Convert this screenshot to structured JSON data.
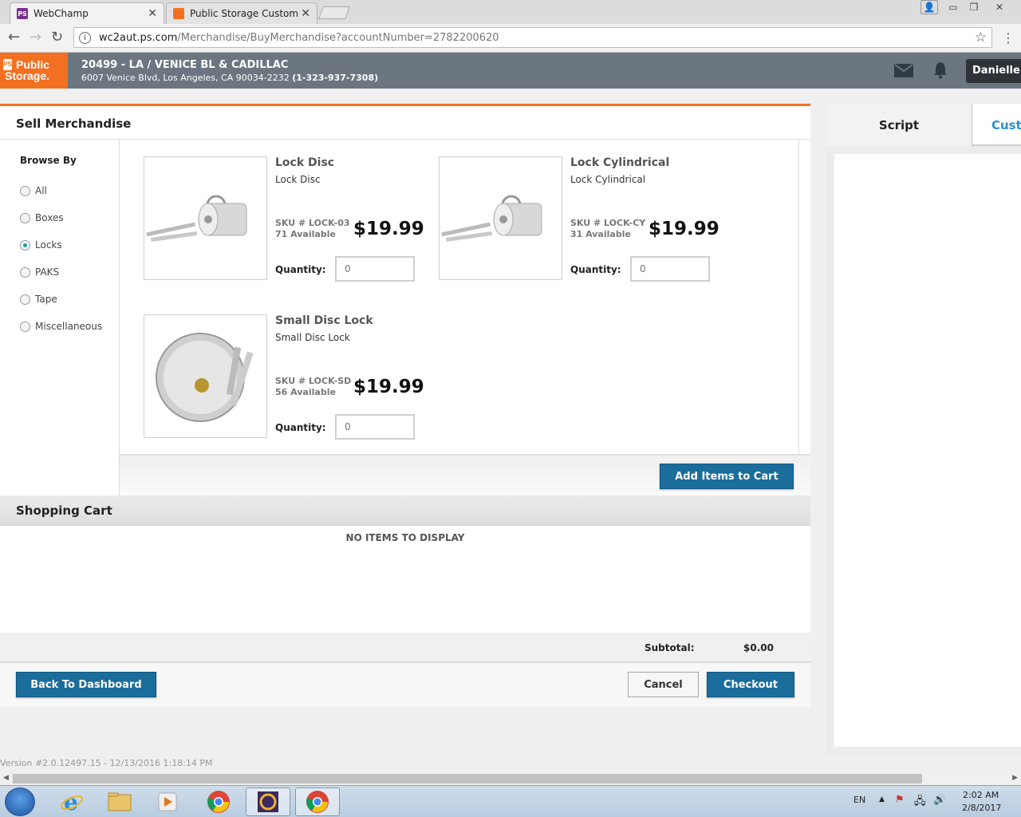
{
  "browser": {
    "tabs": [
      {
        "title": "WebChamp",
        "favicon_color": "#7b2d8e",
        "active": true
      },
      {
        "title": "Public Storage Customer",
        "favicon_color": "#f37021",
        "active": false
      }
    ],
    "url_host": "wc2aut.ps.com",
    "url_path": "/Merchandise/BuyMerchandise?accountNumber=2782200620"
  },
  "header": {
    "logo_line1": "Public",
    "logo_line2": "Storage.",
    "store_title": "20499 - LA / VENICE BL & CADILLAC",
    "store_address": "6007 Venice Blvd, Los Angeles, CA 90034-2232",
    "store_phone": "(1-323-937-7308)",
    "user_name": "Danielle"
  },
  "page": {
    "title": "Sell Merchandise",
    "browse_by_label": "Browse By",
    "categories": [
      {
        "label": "All",
        "selected": false
      },
      {
        "label": "Boxes",
        "selected": false
      },
      {
        "label": "Locks",
        "selected": true
      },
      {
        "label": "PAKS",
        "selected": false
      },
      {
        "label": "Tape",
        "selected": false
      },
      {
        "label": "Miscellaneous",
        "selected": false
      }
    ],
    "products": [
      {
        "name": "Lock Disc",
        "description": "Lock Disc",
        "sku": "SKU # LOCK-03",
        "available": "71 Available",
        "price": "$19.99",
        "quantity_label": "Quantity:",
        "quantity_value": "0"
      },
      {
        "name": "Lock Cylindrical",
        "description": "Lock Cylindrical",
        "sku": "SKU # LOCK-CY",
        "available": "31 Available",
        "price": "$19.99",
        "quantity_label": "Quantity:",
        "quantity_value": "0"
      },
      {
        "name": "Small Disc Lock",
        "description": "Small Disc Lock",
        "sku": "SKU # LOCK-SD",
        "available": "56 Available",
        "price": "$19.99",
        "quantity_label": "Quantity:",
        "quantity_value": "0"
      }
    ],
    "add_to_cart_label": "Add Items to Cart"
  },
  "cart": {
    "title": "Shopping Cart",
    "empty_message": "NO ITEMS TO DISPLAY",
    "subtotal_label": "Subtotal:",
    "subtotal_value": "$0.00"
  },
  "footer": {
    "back_label": "Back To Dashboard",
    "cancel_label": "Cancel",
    "checkout_label": "Checkout",
    "version": "Version #2.0.12497.15 - 12/13/2016 1:18:14 PM"
  },
  "right_panel": {
    "tab_script": "Script",
    "tab_customer": "Customer"
  },
  "taskbar": {
    "lang": "EN",
    "time": "2:02 AM",
    "date": "2/8/2017"
  },
  "colors": {
    "brand_orange": "#f37021",
    "button_blue": "#1b6d9b",
    "header_gray": "#6b7680"
  }
}
